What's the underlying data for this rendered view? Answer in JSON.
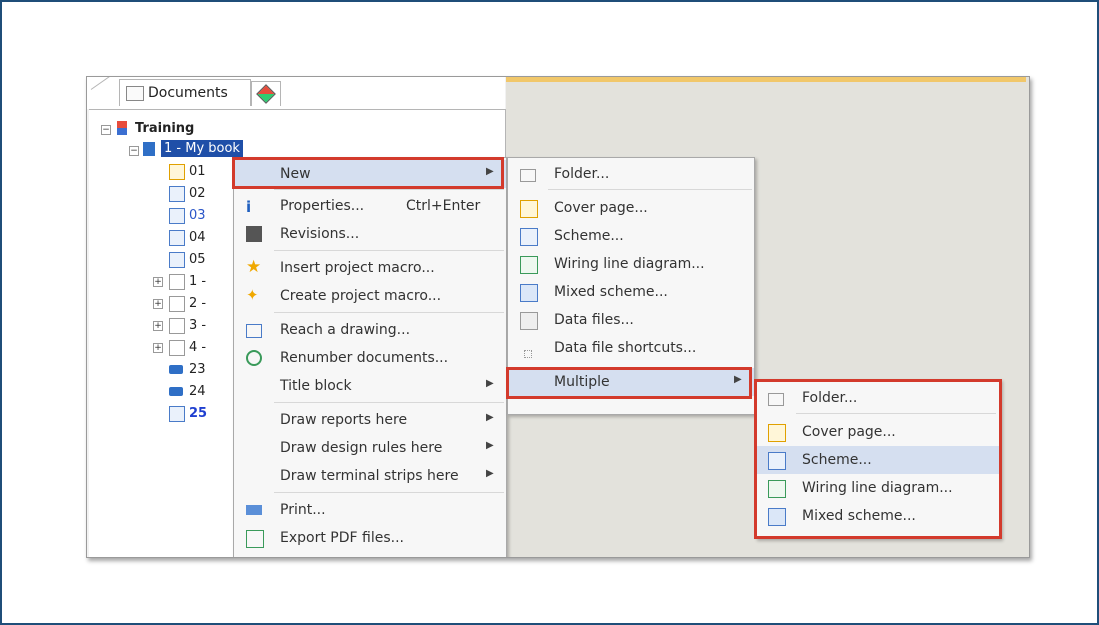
{
  "tabs": {
    "documents": "Documents"
  },
  "tree": {
    "root": "Training",
    "book": "1 - My book",
    "items": [
      "01",
      "02",
      "03",
      "04",
      "05",
      "1 -",
      "2 -",
      "3 -",
      "4 -",
      "23",
      "24",
      "25"
    ]
  },
  "context_menu": {
    "items": [
      {
        "label": "New"
      },
      {
        "label": "Properties...",
        "shortcut": "Ctrl+Enter"
      },
      {
        "label": "Revisions..."
      },
      {
        "label": "Insert project macro..."
      },
      {
        "label": "Create project macro..."
      },
      {
        "label": "Reach a drawing..."
      },
      {
        "label": "Renumber documents..."
      },
      {
        "label": "Title block"
      },
      {
        "label": "Draw reports here"
      },
      {
        "label": "Draw design rules here"
      },
      {
        "label": "Draw terminal strips here"
      },
      {
        "label": "Print..."
      },
      {
        "label": "Export PDF files..."
      }
    ]
  },
  "new_submenu": {
    "items": [
      {
        "label": "Folder..."
      },
      {
        "label": "Cover page..."
      },
      {
        "label": "Scheme..."
      },
      {
        "label": "Wiring line diagram..."
      },
      {
        "label": "Mixed scheme..."
      },
      {
        "label": "Data files..."
      },
      {
        "label": "Data file shortcuts..."
      },
      {
        "label": "Multiple"
      }
    ]
  },
  "multiple_submenu": {
    "items": [
      {
        "label": "Folder..."
      },
      {
        "label": "Cover page..."
      },
      {
        "label": "Scheme..."
      },
      {
        "label": "Wiring line diagram..."
      },
      {
        "label": "Mixed scheme..."
      }
    ]
  },
  "colors": {
    "highlight_border": "#d33a2c",
    "selection": "#1f4fa8",
    "hover": "#d5dff0",
    "frame": "#1f4e79"
  }
}
